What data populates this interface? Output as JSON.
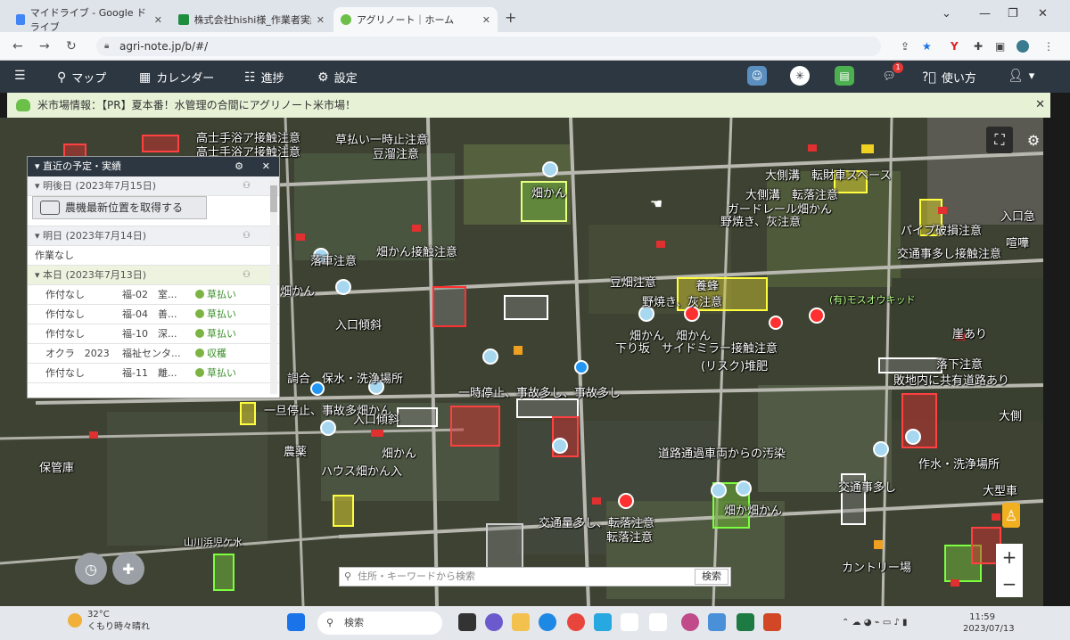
{
  "browser": {
    "tabs": [
      {
        "title": "マイドライブ - Google ドライブ",
        "color": "#4285f4"
      },
      {
        "title": "株式会社hishi様_作業者実績分析",
        "color": "#1e8e3e"
      },
      {
        "title": "アグリノート｜ホーム",
        "color": "#6cc04a"
      }
    ],
    "url": "agri-note.jp/b/#/"
  },
  "nav": {
    "map": "マップ",
    "calendar": "カレンダー",
    "progress": "進捗",
    "settings": "設定",
    "help": "使い方",
    "notification_count": "1"
  },
  "announcement": "米市場情報：【PR】夏本番！水管理の合間にアグリノート米市場！",
  "panel": {
    "title": "直近の予定・実績",
    "tractor_button": "農機最新位置を取得する",
    "day_after_tomorrow": "明後日 (2023年7月15日)",
    "tomorrow": "明日 (2023年7月14日)",
    "no_work": "作業なし",
    "today": "本日 (2023年7月13日)",
    "rows": [
      {
        "crop": "作付なし",
        "field": "福-02　室...",
        "task": "草払い"
      },
      {
        "crop": "作付なし",
        "field": "福-04　善...",
        "task": "草払い"
      },
      {
        "crop": "作付なし",
        "field": "福-10　深...",
        "task": "草払い"
      },
      {
        "crop": "オクラ　2023",
        "field": "福祉センタ...",
        "task": "収穫"
      },
      {
        "crop": "作付なし",
        "field": "福-11　離...",
        "task": "草払い"
      }
    ]
  },
  "map_labels": [
    "高士手浴ア接触注意",
    "高士手浴ア接触注意",
    "草払い一時止注意",
    "豆溜注意",
    "畑かん",
    "大側溝　転財車スペース",
    "大側溝　転落注意",
    "ガードレール畑かん",
    "野焼き、灰注意",
    "パイプ破損注意",
    "入口急",
    "交通事多し接触注意",
    "喧嘩",
    "畑かん接触注意",
    "落車注意",
    "畑かん",
    "豆畑注意",
    "入口傾斜",
    "養蜂",
    "野焼き、灰注意",
    "(有)モスオウキッド",
    "畑かん　畑かん",
    "下り坂　サイドミラー接触注意",
    "(リスク)堆肥",
    "崖あり",
    "落下注意",
    "敗地内に共有道路あり",
    "調合　保水・洗浄場所",
    "一時停止、事故多し、事故多し",
    "一旦停止、事故多畑かん",
    "入口傾斜",
    "大側",
    "畑かん",
    "道路通過車両からの汚染",
    "農薬",
    "ハウス畑かん入",
    "保管庫",
    "作水・洗浄場所",
    "交通事多し",
    "大型車",
    "畑か畑かん",
    "交通量多し、転落注意",
    "転落注意",
    "山川浜児ケ水",
    "カントリー場"
  ],
  "search": {
    "placeholder": "住所・キーワードから検索",
    "button": "検索"
  },
  "taskbar": {
    "temperature": "32°C",
    "weather": "くもり時々晴れ",
    "search": "検索",
    "time": "11:59",
    "date": "2023/07/13"
  }
}
